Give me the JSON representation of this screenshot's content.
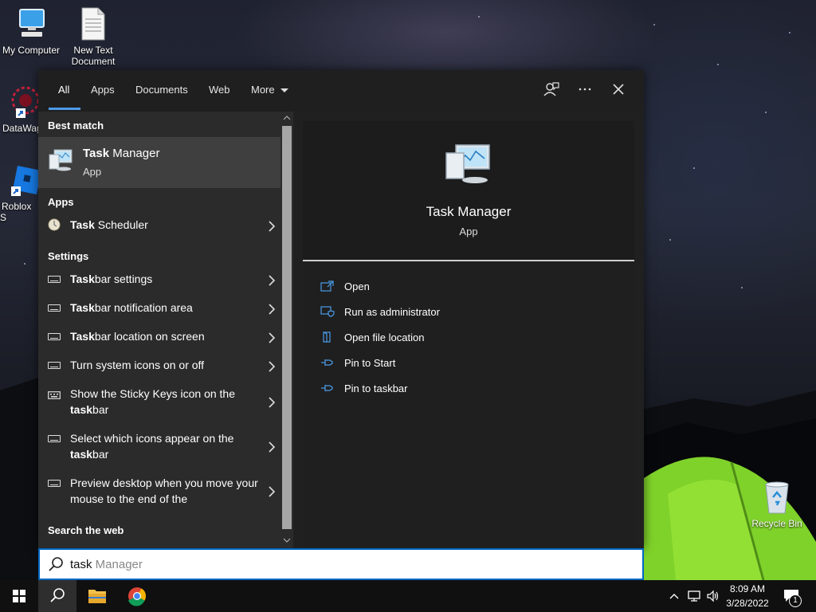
{
  "desktop": {
    "icons": [
      {
        "label": "My Computer",
        "icon": "computer-icon"
      },
      {
        "label": "New Text Document",
        "icon": "text-document-icon"
      },
      {
        "label": "DataWag",
        "icon": "datawag-shortcut-icon"
      },
      {
        "label": "Roblox S",
        "icon": "roblox-shortcut-icon"
      },
      {
        "label": "Recycle Bin",
        "icon": "recycle-bin-icon"
      }
    ]
  },
  "search": {
    "tabs": [
      {
        "label": "All",
        "active": true
      },
      {
        "label": "Apps"
      },
      {
        "label": "Documents"
      },
      {
        "label": "Web"
      },
      {
        "label": "More"
      }
    ],
    "header_icons": [
      "feedback-icon",
      "more-options-icon",
      "close-icon"
    ],
    "best_match": {
      "section_title": "Best match",
      "title_bold": "Task",
      "title_rest": " Manager",
      "subtitle": "App"
    },
    "apps": {
      "section_title": "Apps",
      "items": [
        {
          "bold": "Task",
          "rest": " Scheduler"
        }
      ]
    },
    "settings": {
      "section_title": "Settings",
      "items": [
        {
          "bold": "Task",
          "rest": "bar settings"
        },
        {
          "bold": "Task",
          "rest": "bar notification area"
        },
        {
          "bold": "Task",
          "rest": "bar location on screen"
        },
        {
          "pre": "Turn system icons on or off"
        },
        {
          "pre": "Show the Sticky Keys icon on the ",
          "bold": "task",
          "rest": "bar"
        },
        {
          "pre": "Select which icons appear on the ",
          "bold": "task",
          "rest": "bar"
        },
        {
          "pre": "Preview desktop when you move your mouse to the end of the"
        }
      ]
    },
    "web": {
      "section_title": "Search the web"
    },
    "preview": {
      "title": "Task Manager",
      "subtitle": "App",
      "actions": [
        {
          "label": "Open",
          "icon": "open-icon"
        },
        {
          "label": "Run as administrator",
          "icon": "run-as-admin-icon"
        },
        {
          "label": "Open file location",
          "icon": "file-location-icon"
        },
        {
          "label": "Pin to Start",
          "icon": "pin-icon"
        },
        {
          "label": "Pin to taskbar",
          "icon": "pin-icon"
        }
      ]
    },
    "box": {
      "typed": "task",
      "suggestion": " Manager"
    }
  },
  "taskbar": {
    "clock_time": "8:09 AM",
    "clock_date": "3/28/2022",
    "notification_count": "1",
    "apps": [
      "start-button",
      "search-button",
      "file-explorer",
      "chrome"
    ]
  },
  "colors": {
    "accent": "#4c9be8",
    "panel_bg": "#202020",
    "left_bg": "#2b2b2b",
    "selected_bg": "#3f3f3f",
    "taskbar_bg": "#101010"
  }
}
